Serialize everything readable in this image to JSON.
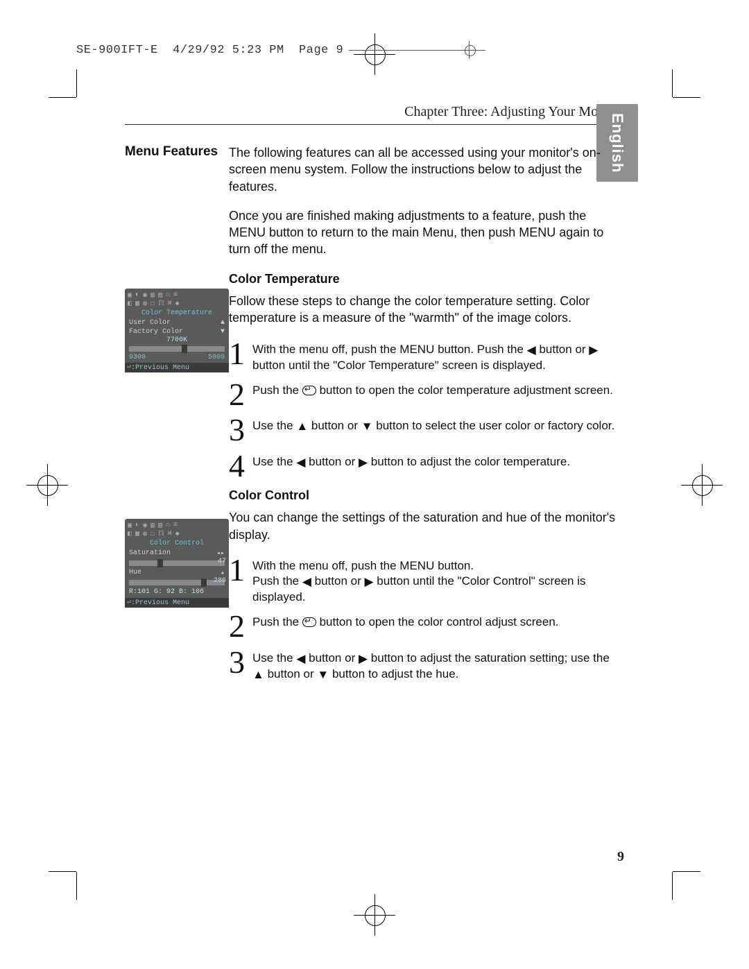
{
  "slug": "SE-900IFT-E  4/29/92 5:23 PM  Page 9",
  "chapter": "Chapter Three: Adjusting Your Monitor",
  "lang_tab": "English",
  "side_heading": "Menu Features",
  "intro1": "The following features can all be accessed using your monitor's on-screen menu system. Follow the instructions below to adjust the features.",
  "intro2": "Once you are finished making adjustments to a feature, push the MENU button to return to the main Menu, then push MENU again to turn off the menu.",
  "sec1": {
    "title": "Color Temperature",
    "lead": "Follow these steps to change the color temperature setting. Color temperature is a measure of the \"warmth\" of the image colors.",
    "steps": {
      "s1a": "With the menu off, push the MENU button. Push the",
      "s1b": " button or ",
      "s1c": " button until the \"Color Temperature\" screen is displayed.",
      "s2a": "Push the ",
      "s2b": " button to open the color temperature adjustment screen.",
      "s3a": "Use the ",
      "s3b": " button or ",
      "s3c": " button to select the user color or factory color.",
      "s4a": "Use the ",
      "s4b": " button or ",
      "s4c": " button to adjust the color temperature."
    }
  },
  "sec2": {
    "title": "Color Control",
    "lead": "You can change the settings of the saturation and hue of the monitor's display.",
    "steps": {
      "s1a": "With the menu off, push the MENU button.",
      "s1b": "Push the ",
      "s1c": " button or ",
      "s1d": " button until the \"Color Control\" screen is displayed.",
      "s2a": "Push the ",
      "s2b": " button to open the color control adjust screen.",
      "s3a": "Use the ",
      "s3b": " button or ",
      "s3c": " button to adjust the saturation setting; use the ",
      "s3d": " button or ",
      "s3e": " button to adjust the hue."
    }
  },
  "osd1": {
    "title": "Color Temperature",
    "row1_label": "User Color",
    "row2_label": "Factory Color",
    "value": "7700K",
    "scale_lo": "9300",
    "scale_hi": "5000",
    "prev": ":Previous Menu"
  },
  "osd2": {
    "title": "Color Control",
    "row1_label": "Saturation",
    "row1_val": "47",
    "row2_label": "Hue",
    "row2_val": "286",
    "rgb": "R:101 G: 92 B: 106",
    "prev": ":Previous Menu"
  },
  "nums": {
    "n1": "1",
    "n2": "2",
    "n3": "3",
    "n4": "4"
  },
  "page_number": "9"
}
